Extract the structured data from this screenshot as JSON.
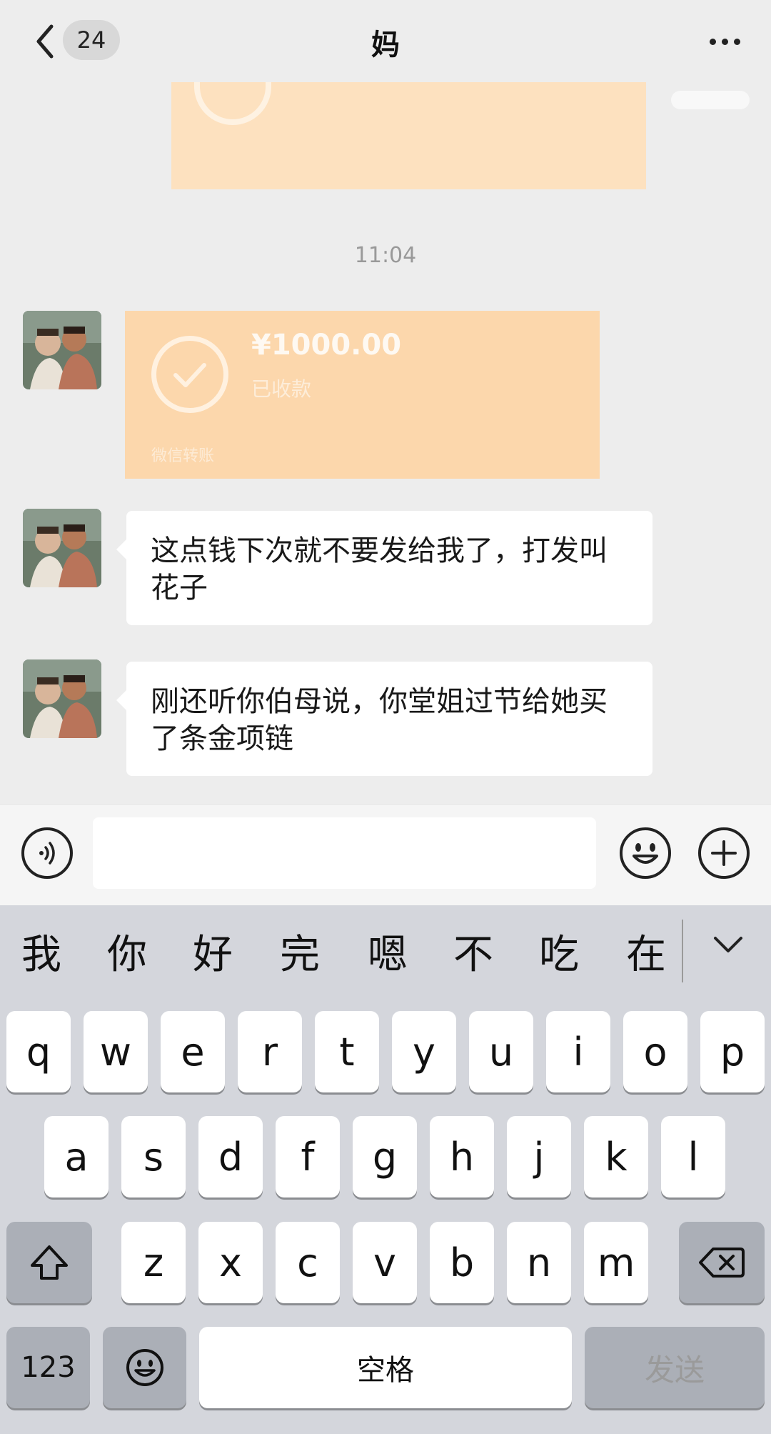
{
  "header": {
    "unread_count": "24",
    "title": "妈"
  },
  "chat": {
    "timestamp": "11:04",
    "transfer": {
      "amount": "¥1000.00",
      "status": "已收款",
      "footer": "微信转账"
    },
    "messages": [
      {
        "sender": "mom",
        "text": "这点钱下次就不要发给我了，打发叫花子"
      },
      {
        "sender": "mom",
        "text": "刚还听你伯母说，你堂姐过节给她买了条金项链"
      }
    ]
  },
  "input": {
    "value": ""
  },
  "keyboard": {
    "candidates": [
      "我",
      "你",
      "好",
      "完",
      "嗯",
      "不",
      "吃",
      "在"
    ],
    "row1": [
      "q",
      "w",
      "e",
      "r",
      "t",
      "y",
      "u",
      "i",
      "o",
      "p"
    ],
    "row2": [
      "a",
      "s",
      "d",
      "f",
      "g",
      "h",
      "j",
      "k",
      "l"
    ],
    "row3": [
      "z",
      "x",
      "c",
      "v",
      "b",
      "n",
      "m"
    ],
    "numbers_label": "123",
    "space_label": "空格",
    "send_label": "发送"
  },
  "colors": {
    "background": "#ededed",
    "transfer_orange": "#fcd7ac",
    "bubble": "#ffffff",
    "keyboard": "#d4d6dc"
  }
}
